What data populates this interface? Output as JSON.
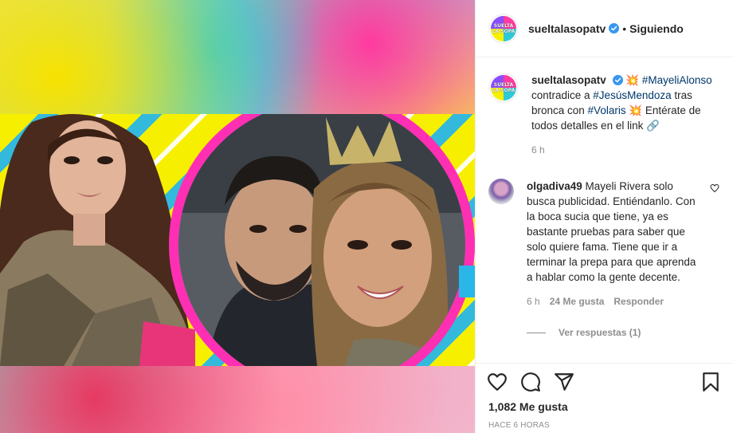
{
  "header": {
    "username": "sueltalasopatv",
    "separator": "•",
    "follow_status": "Siguiendo",
    "logo_text": "SUELTA LA SOPA"
  },
  "caption": {
    "username": "sueltalasopatv",
    "segments": [
      {
        "text": "💥 ",
        "type": "text"
      },
      {
        "text": "#MayeliAlonso",
        "type": "hashtag"
      },
      {
        "text": " contradice a ",
        "type": "text"
      },
      {
        "text": "#JesúsMendoza",
        "type": "hashtag"
      },
      {
        "text": " tras bronca con ",
        "type": "text"
      },
      {
        "text": "#Volaris",
        "type": "hashtag"
      },
      {
        "text": " 💥 Entérate de todos detalles en el link 🔗",
        "type": "text"
      }
    ],
    "time": "6 h"
  },
  "comment": {
    "username": "olgadiva49",
    "text": "Mayeli Rivera solo busca publicidad. Entiéndanlo. Con la boca sucia que tiene, ya es bastante pruebas para saber que solo quiere fama. Tiene que ir a terminar la prepa para que aprenda a hablar como la gente decente.",
    "time": "6 h",
    "likes": "24 Me gusta",
    "reply": "Responder",
    "view_replies": "Ver respuestas (1)"
  },
  "footer": {
    "likes": "1,082 Me gusta",
    "posted": "HACE 6 HORAS"
  },
  "colors": {
    "verified_blue": "#3897f0",
    "hashtag": "#00376b",
    "muted": "#8e8e8e",
    "frame_pink": "#ff2fb4",
    "bg_yellow": "#f6f000",
    "stripe_cyan": "#29b6e8"
  },
  "icons": [
    "heart-icon",
    "comment-icon",
    "share-icon",
    "bookmark-icon",
    "verified-badge-icon"
  ]
}
